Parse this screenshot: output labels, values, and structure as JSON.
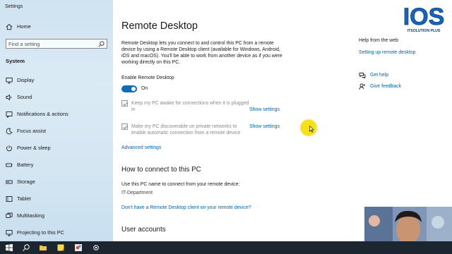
{
  "window": {
    "title": "Settings"
  },
  "sidebar": {
    "home_label": "Home",
    "search_placeholder": "Find a setting",
    "section_title": "System",
    "items": [
      {
        "label": "Display",
        "icon": "monitor-icon"
      },
      {
        "label": "Sound",
        "icon": "speaker-icon"
      },
      {
        "label": "Notifications & actions",
        "icon": "notification-icon"
      },
      {
        "label": "Focus assist",
        "icon": "moon-icon"
      },
      {
        "label": "Power & sleep",
        "icon": "power-icon"
      },
      {
        "label": "Battery",
        "icon": "battery-icon"
      },
      {
        "label": "Storage",
        "icon": "storage-icon"
      },
      {
        "label": "Tablet",
        "icon": "tablet-icon"
      },
      {
        "label": "Multitasking",
        "icon": "multitasking-icon"
      },
      {
        "label": "Projecting to this PC",
        "icon": "projecting-icon"
      }
    ]
  },
  "main": {
    "title": "Remote Desktop",
    "description": "Remote Desktop lets you connect to and control this PC from a remote device by using a Remote Desktop client (available for Windows, Android, iOS and macOS). You'll be able to work from another device as if you were working directly on this PC.",
    "enable_label": "Enable Remote Desktop",
    "toggle_state": "On",
    "option1_text": "Keep my PC awake for connections when it is plugged in",
    "option2_text": "Make my PC discoverable on private networks to enable automatic connection from a remote device",
    "show_settings_label": "Show settings",
    "advanced_settings": "Advanced settings",
    "how_to_connect_title": "How to connect to this PC",
    "use_name_text": "Use this PC name to connect from your remote device:",
    "pc_name": "IT-Department",
    "no_client_link": "Don't have a Remote Desktop client on your remote device?",
    "user_accounts_title": "User accounts"
  },
  "help": {
    "title": "Help from the web",
    "link": "Setting up remote desktop",
    "get_help": "Get help",
    "give_feedback": "Give feedback"
  },
  "logo": {
    "text": "IOS",
    "subtext": "ITSOLUTION PLUS"
  },
  "colors": {
    "accent": "#0f6cbd",
    "link": "#0063b1",
    "taskbar": "#1b2631",
    "sidebar": "#d4e6f2"
  }
}
